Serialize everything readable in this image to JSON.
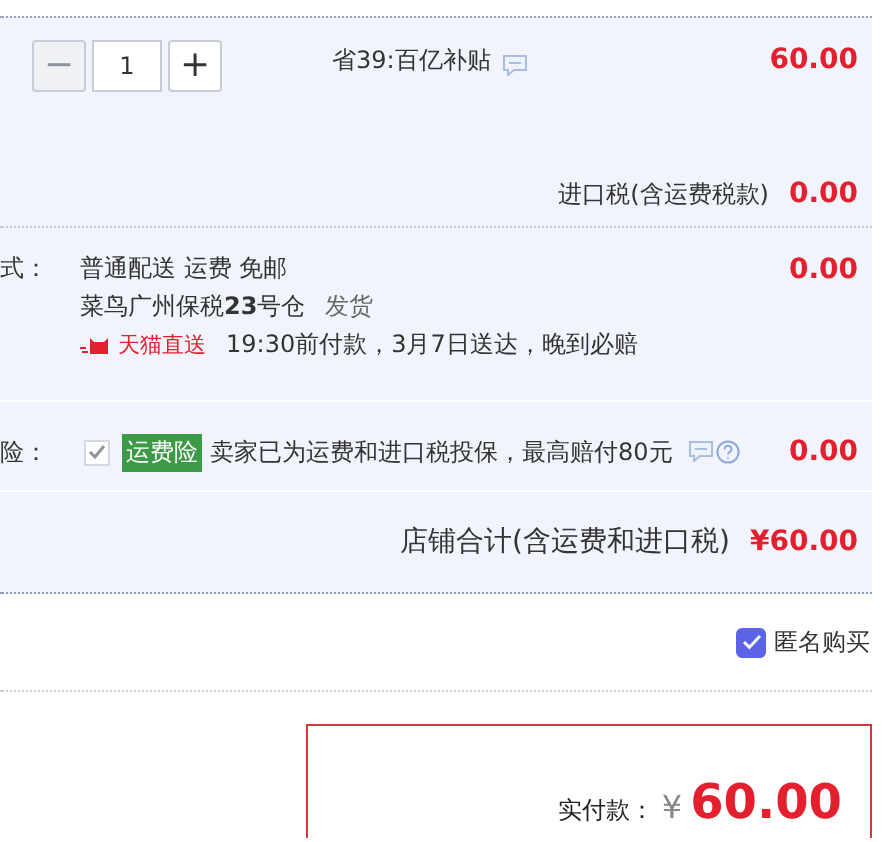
{
  "item": {
    "stepper": {
      "minus": {
        "label": "−",
        "disabled": true
      },
      "quantity": "1",
      "plus": {
        "label": "+",
        "disabled": false
      }
    },
    "promo": "省39:百亿补贴",
    "price": "60.00"
  },
  "import_tax": {
    "label": "进口税(含运费税款)",
    "amount": "0.00"
  },
  "shipping": {
    "label": "式：",
    "method": "普通配送 运费 免邮",
    "warehouse": "菜鸟广州保税**23**号仓",
    "dispatch": "发货",
    "badge": "天猫直送",
    "promise": "19:30前付款，3月7日送达，晚到必赔",
    "amount": "0.00"
  },
  "insurance": {
    "label": "险：",
    "checked": true,
    "disabled": true,
    "tag": "运费险",
    "text": "卖家已为运费和进口税投保，最高赔付80元",
    "amount": "0.00"
  },
  "store_total": {
    "label": "店铺合计(含运费和进口税)",
    "amount": "¥60.00"
  },
  "anonymous": {
    "label": "匿名购买",
    "checked": true
  },
  "payment": {
    "label": "实付款：",
    "currency": "¥",
    "amount": "60.00"
  }
}
